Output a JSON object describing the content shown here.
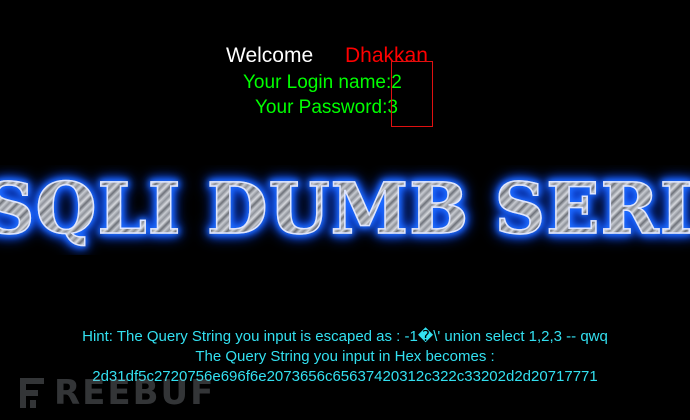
{
  "welcome": {
    "label": "Welcome",
    "name": "Dhakkan"
  },
  "login": {
    "name_line": "Your Login name:2",
    "password_line": "Your Password:3"
  },
  "banner": {
    "text": "SQLI DUMB SERIES"
  },
  "hint": {
    "escaped_line": "Hint: The Query String you input is escaped as : -1�\\' union select 1,2,3 -- qwq",
    "hex_label": "The Query String you input in Hex becomes :",
    "hex_value": "2d31df5c2720756e696f6e2073656c65637420312c322c33202d2d20717771"
  },
  "watermark": {
    "text": "REEBUF"
  },
  "colors": {
    "background": "#000000",
    "welcome": "#ffffff",
    "user_name": "#ff0000",
    "login_info": "#00ff00",
    "hint": "#33e0f0",
    "highlight_box": "#e01010",
    "banner_glow": "#1f6dff"
  }
}
